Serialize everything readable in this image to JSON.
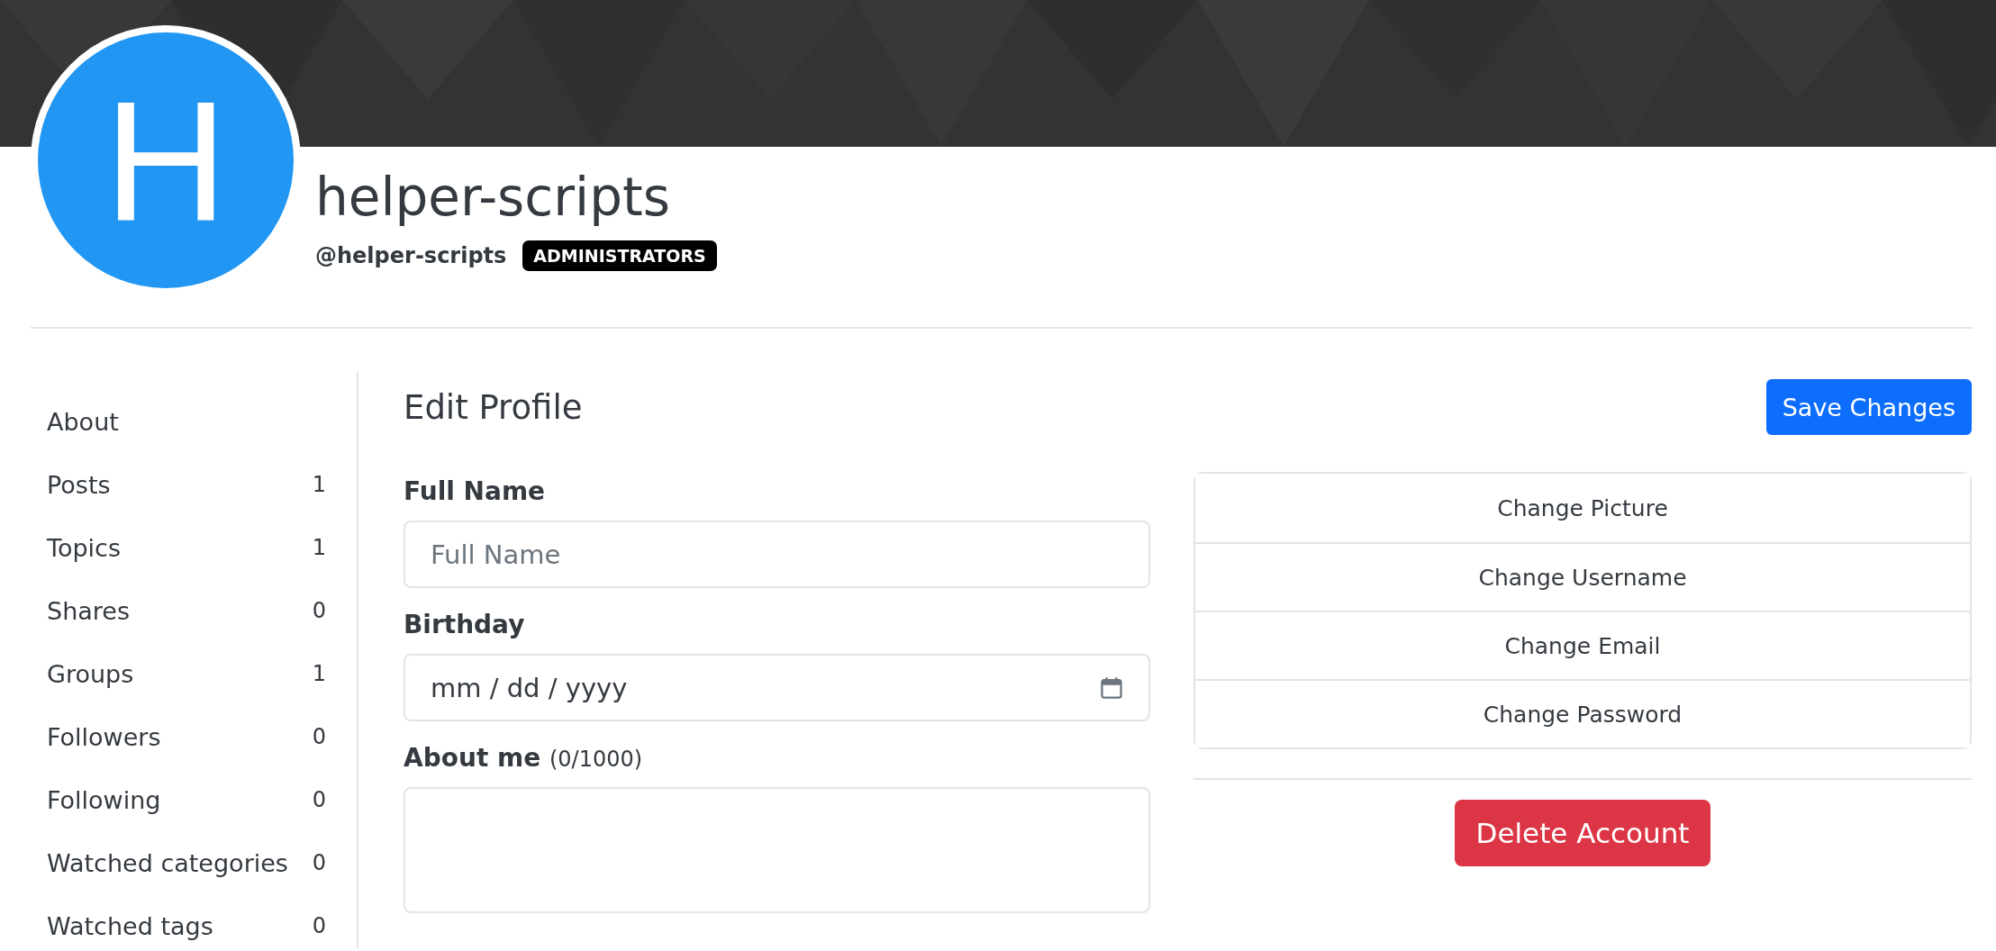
{
  "avatar": {
    "letter": "H"
  },
  "user": {
    "display_name": "helper-scripts",
    "username": "@helper-scripts",
    "badge": "ADMINISTRATORS"
  },
  "sidebar": {
    "items": [
      {
        "label": "About"
      },
      {
        "label": "Posts",
        "count": "1"
      },
      {
        "label": "Topics",
        "count": "1"
      },
      {
        "label": "Shares",
        "count": "0"
      },
      {
        "label": "Groups",
        "count": "1"
      },
      {
        "label": "Followers",
        "count": "0"
      },
      {
        "label": "Following",
        "count": "0"
      },
      {
        "label": "Watched categories",
        "count": "0"
      },
      {
        "label": "Watched tags",
        "count": "0"
      }
    ]
  },
  "edit_profile": {
    "title": "Edit Profile",
    "save_button": "Save Changes",
    "fields": [
      {
        "kind": "text",
        "label": "Full Name",
        "placeholder": "Full Name"
      },
      {
        "kind": "date",
        "label": "Birthday",
        "placeholder": "mm / dd / yyyy"
      },
      {
        "kind": "textarea",
        "label": "About me",
        "counter": "(0/1000)"
      }
    ]
  },
  "account_actions": [
    "Change Picture",
    "Change Username",
    "Change Email",
    "Change Password"
  ],
  "delete_button": "Delete Account"
}
